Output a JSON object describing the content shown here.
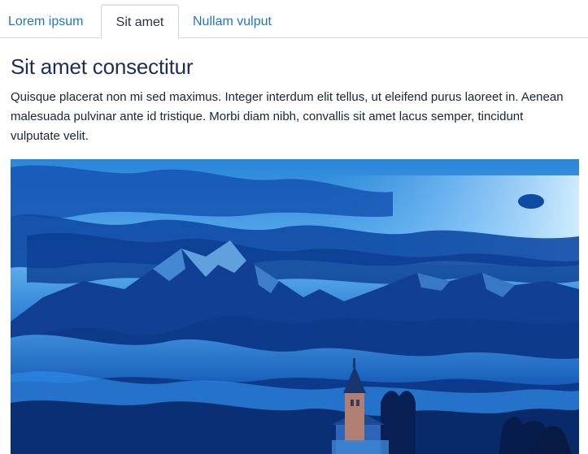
{
  "tabs": [
    {
      "label": "Lorem ipsum",
      "active": false
    },
    {
      "label": "Sit amet",
      "active": true
    },
    {
      "label": "Nullam vulput",
      "active": false
    }
  ],
  "panel": {
    "heading": "Sit amet consectitur",
    "body": "Quisque placerat non mi sed maximus. Integer interdum elit tellus, ut eleifend purus laoreet in. Aenean malesuada pulvinar ante id tristique. Morbi diam nibh, convallis sit amet lacus semper, tincidunt vulputate velit."
  },
  "image": {
    "subject": "mountain-landscape-with-church-tower",
    "tint_color": "#1a6fd6"
  },
  "colors": {
    "link": "#1d78bf",
    "heading": "#1f2d5a",
    "text": "#1b2433"
  }
}
